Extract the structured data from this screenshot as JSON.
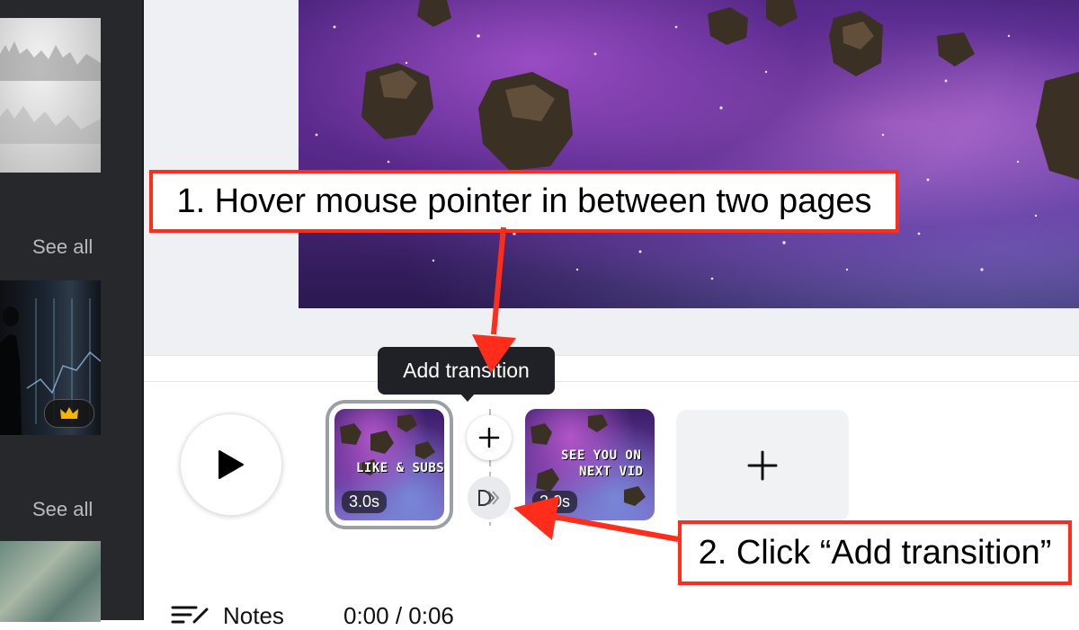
{
  "sidebar": {
    "see_all_1": "See all",
    "see_all_2": "See all",
    "premium_badge_icon": "crown-icon"
  },
  "timeline": {
    "play_icon": "play-icon",
    "pages": [
      {
        "text": "LIKE & SUBS",
        "duration": "3.0s",
        "selected": true
      },
      {
        "text_line1": "SEE YOU ON",
        "text_line2": "NEXT VID",
        "duration": "3.0s",
        "selected": false
      }
    ],
    "add_page_icon": "plus-icon",
    "insert_icon": "plus-icon",
    "transition_icon": "transition-icon",
    "tooltip": "Add transition"
  },
  "footer": {
    "notes_label": "Notes",
    "time": "0:00 / 0:06"
  },
  "annotations": {
    "step1": "1. Hover mouse pointer in between two pages",
    "step2": "2. Click “Add transition”",
    "color": "#ff2d1a"
  }
}
